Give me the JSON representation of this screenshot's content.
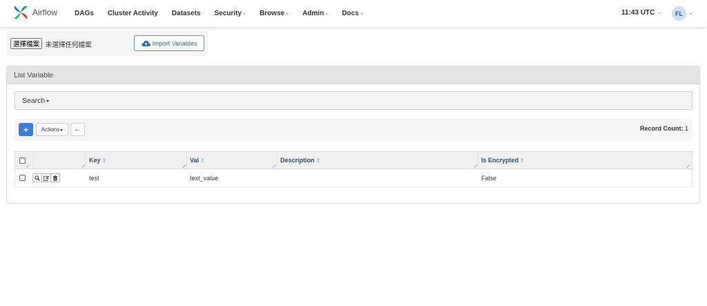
{
  "brand": {
    "name": "Airflow"
  },
  "nav": {
    "items": [
      {
        "label": "DAGs",
        "dropdown": false
      },
      {
        "label": "Cluster Activity",
        "dropdown": false
      },
      {
        "label": "Datasets",
        "dropdown": false
      },
      {
        "label": "Security",
        "dropdown": true
      },
      {
        "label": "Browse",
        "dropdown": true
      },
      {
        "label": "Admin",
        "dropdown": true
      },
      {
        "label": "Docs",
        "dropdown": true
      }
    ],
    "clock": "11:43 UTC",
    "user_initials": "FL"
  },
  "import": {
    "file_button": "選擇檔案",
    "file_status": "未選擇任何檔案",
    "import_label": "Import Variables"
  },
  "list": {
    "title": "List Variable",
    "search_label": "Search",
    "add_label": "+",
    "actions_label": "Actions",
    "back_label": "←",
    "record_count_label": "Record Count:",
    "record_count_value": "1",
    "columns": [
      "Key",
      "Val",
      "Description",
      "Is Encrypted"
    ],
    "rows": [
      {
        "key": "test",
        "val": "test_value",
        "description": "",
        "is_encrypted": "False"
      }
    ]
  },
  "colors": {
    "primary": "#3b7dd8",
    "header_text": "#2f4f6f",
    "panel_header": "#e5e5e5"
  },
  "icons": {
    "brand": "airflow-pinwheel-icon",
    "import": "cloud-upload-icon",
    "row_view": "search-icon",
    "row_edit": "edit-icon",
    "row_delete": "trash-icon"
  }
}
